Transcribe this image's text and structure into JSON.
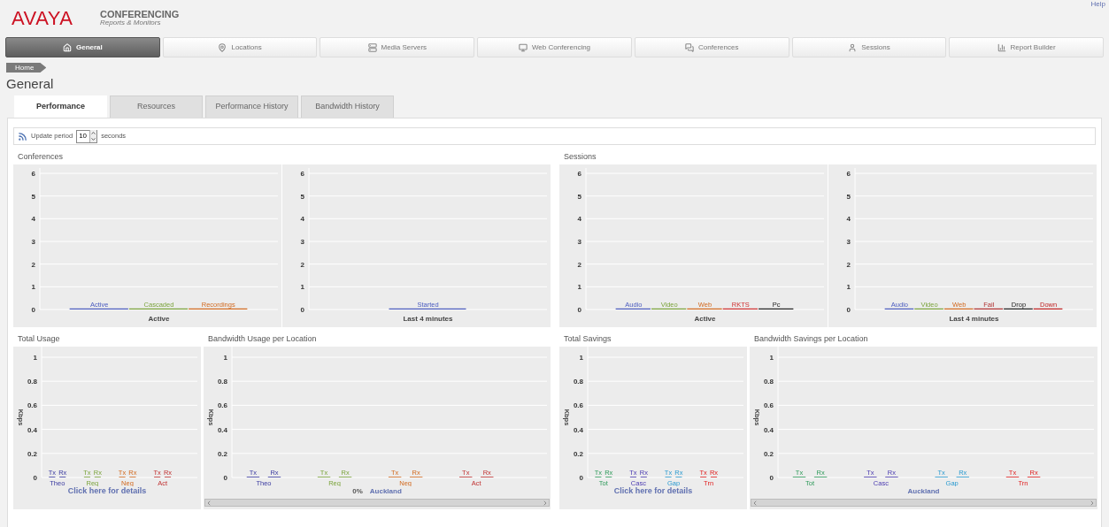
{
  "header": {
    "logo": "AVAYA",
    "product": "CONFERENCING",
    "subtitle": "Reports & Monitors",
    "help_link": "Help"
  },
  "nav": [
    {
      "label": "General",
      "selected": true
    },
    {
      "label": "Locations",
      "selected": false
    },
    {
      "label": "Media Servers",
      "selected": false
    },
    {
      "label": "Web Conferencing",
      "selected": false
    },
    {
      "label": "Conferences",
      "selected": false
    },
    {
      "label": "Sessions",
      "selected": false
    },
    {
      "label": "Report Builder",
      "selected": false
    }
  ],
  "breadcrumb": [
    "Home"
  ],
  "page_title": "General",
  "tabs": [
    {
      "label": "Performance",
      "selected": true
    },
    {
      "label": "Resources",
      "selected": false
    },
    {
      "label": "Performance History",
      "selected": false
    },
    {
      "label": "Bandwidth History",
      "selected": false
    }
  ],
  "update_period": {
    "label": "Update period",
    "value": "10",
    "unit": "seconds"
  },
  "sections": [
    {
      "panels": [
        {
          "title": "Conferences",
          "charts": [
            {
              "kind": "count",
              "chart_data": {
                "type": "bar",
                "xlabel": "Active",
                "categories": [
                  "Active",
                  "Cascaded",
                  "Recordings"
                ],
                "values": [
                  0,
                  0,
                  0
                ],
                "colors": [
                  "#4a5bbf",
                  "#7aa33a",
                  "#d2691e"
                ],
                "ylim": [
                  0,
                  6
                ],
                "yticks": [
                  0,
                  1,
                  2,
                  3,
                  4,
                  5,
                  6
                ],
                "grid": true
              }
            },
            {
              "kind": "count",
              "chart_data": {
                "type": "bar",
                "xlabel": "Last 4 minutes",
                "categories": [
                  "Started"
                ],
                "values": [
                  0
                ],
                "colors": [
                  "#4a5bbf"
                ],
                "ylim": [
                  0,
                  6
                ],
                "yticks": [
                  0,
                  1,
                  2,
                  3,
                  4,
                  5,
                  6
                ],
                "grid": true
              }
            }
          ]
        },
        {
          "title": "Sessions",
          "charts": [
            {
              "kind": "count",
              "chart_data": {
                "type": "bar",
                "xlabel": "Active",
                "categories": [
                  "Audio",
                  "Video",
                  "Web",
                  "RKTS",
                  "Pc"
                ],
                "values": [
                  0,
                  0,
                  0,
                  0,
                  0
                ],
                "colors": [
                  "#4a5bbf",
                  "#7aa33a",
                  "#d2691e",
                  "#d03030",
                  "#222222"
                ],
                "ylim": [
                  0,
                  6
                ],
                "yticks": [
                  0,
                  1,
                  2,
                  3,
                  4,
                  5,
                  6
                ],
                "grid": true
              }
            },
            {
              "kind": "count",
              "chart_data": {
                "type": "bar",
                "xlabel": "Last 4 minutes",
                "categories": [
                  "Audio",
                  "Video",
                  "Web",
                  "Fail",
                  "Drop",
                  "Down"
                ],
                "values": [
                  0,
                  0,
                  0,
                  0,
                  0,
                  0
                ],
                "colors": [
                  "#4a5bbf",
                  "#7aa33a",
                  "#d2691e",
                  "#b03030",
                  "#222222",
                  "#c02020"
                ],
                "ylim": [
                  0,
                  6
                ],
                "yticks": [
                  0,
                  1,
                  2,
                  3,
                  4,
                  5,
                  6
                ],
                "grid": true
              }
            }
          ]
        }
      ]
    },
    {
      "panels": [
        {
          "title": "Total Usage",
          "charts": [
            {
              "kind": "traffic",
              "footer": {
                "link": "Click here for details"
              },
              "chart_data": {
                "type": "bar",
                "ylabel": "Kbps",
                "categories": [
                  "Theo",
                  "Req",
                  "Neg",
                  "Act"
                ],
                "series": [
                  {
                    "name": "Tx",
                    "colors": [
                      "#3a3aa0",
                      "#7aa33a",
                      "#d2691e",
                      "#c03030"
                    ],
                    "values": [
                      0,
                      0,
                      0,
                      0
                    ]
                  },
                  {
                    "name": "Rx",
                    "colors": [
                      "#3a3aa0",
                      "#7aa33a",
                      "#d2691e",
                      "#c03030"
                    ],
                    "values": [
                      0,
                      0,
                      0,
                      0
                    ]
                  }
                ],
                "ylim": [
                  0,
                  1
                ],
                "yticks": [
                  0,
                  0.2,
                  0.4,
                  0.6,
                  0.8,
                  1
                ],
                "grid": true
              }
            }
          ]
        },
        {
          "title": "Bandwidth Usage per Location",
          "charts": [
            {
              "kind": "traffic",
              "footer": {
                "percent": "0%",
                "location": "Auckland",
                "scrollbar": true
              },
              "chart_data": {
                "type": "bar",
                "ylabel": "Kbps",
                "categories": [
                  "Theo",
                  "Req",
                  "Neg",
                  "Act"
                ],
                "series": [
                  {
                    "name": "Tx",
                    "colors": [
                      "#3a3aa0",
                      "#7aa33a",
                      "#d2691e",
                      "#c03030"
                    ],
                    "values": [
                      0,
                      0,
                      0,
                      0
                    ]
                  },
                  {
                    "name": "Rx",
                    "colors": [
                      "#3a3aa0",
                      "#7aa33a",
                      "#d2691e",
                      "#c03030"
                    ],
                    "values": [
                      0,
                      0,
                      0,
                      0
                    ]
                  }
                ],
                "ylim": [
                  0,
                  1
                ],
                "yticks": [
                  0,
                  0.2,
                  0.4,
                  0.6,
                  0.8,
                  1
                ],
                "grid": true
              }
            }
          ]
        },
        {
          "title": "Total Savings",
          "charts": [
            {
              "kind": "traffic",
              "footer": {
                "link": "Click here for details"
              },
              "chart_data": {
                "type": "bar",
                "ylabel": "Kbps",
                "categories": [
                  "Tot",
                  "Casc",
                  "Gap",
                  "Trn"
                ],
                "series": [
                  {
                    "name": "Tx",
                    "colors": [
                      "#2e9a5a",
                      "#4a3ab0",
                      "#2a9ad0",
                      "#e02020"
                    ],
                    "values": [
                      0,
                      0,
                      0,
                      0
                    ]
                  },
                  {
                    "name": "Rx",
                    "colors": [
                      "#2e9a5a",
                      "#4a3ab0",
                      "#2a9ad0",
                      "#e02020"
                    ],
                    "values": [
                      0,
                      0,
                      0,
                      0
                    ]
                  }
                ],
                "ylim": [
                  0,
                  1
                ],
                "yticks": [
                  0,
                  0.2,
                  0.4,
                  0.6,
                  0.8,
                  1
                ],
                "grid": true
              }
            }
          ]
        },
        {
          "title": "Bandwidth Savings per Location",
          "charts": [
            {
              "kind": "traffic",
              "footer": {
                "location": "Auckland",
                "scrollbar": true
              },
              "chart_data": {
                "type": "bar",
                "ylabel": "Kbps",
                "categories": [
                  "Tot",
                  "Casc",
                  "Gap",
                  "Trn"
                ],
                "series": [
                  {
                    "name": "Tx",
                    "colors": [
                      "#2e9a5a",
                      "#4a3ab0",
                      "#2a9ad0",
                      "#e02020"
                    ],
                    "values": [
                      0,
                      0,
                      0,
                      0
                    ]
                  },
                  {
                    "name": "Rx",
                    "colors": [
                      "#2e9a5a",
                      "#4a3ab0",
                      "#2a9ad0",
                      "#e02020"
                    ],
                    "values": [
                      0,
                      0,
                      0,
                      0
                    ]
                  }
                ],
                "ylim": [
                  0,
                  1
                ],
                "yticks": [
                  0,
                  0.2,
                  0.4,
                  0.6,
                  0.8,
                  1
                ],
                "grid": true
              }
            }
          ]
        }
      ]
    }
  ]
}
